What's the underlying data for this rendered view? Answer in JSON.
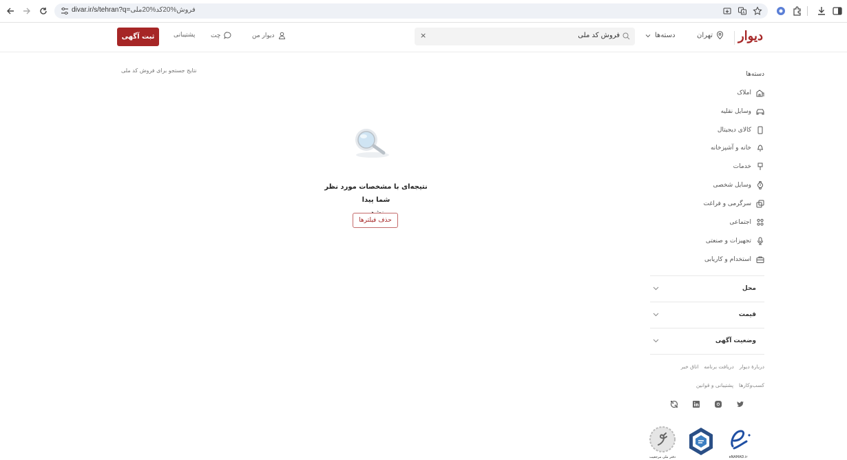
{
  "browser": {
    "url_host": "divar.ir/s/tehran?q=",
    "url_query": "فروش%20کد%20ملی"
  },
  "header": {
    "logo": "دیوار",
    "city": "تهران",
    "categories_label": "دسته‌ها",
    "search_value": "فروش کد ملی",
    "my_divar": "دیوار من",
    "chat": "چت",
    "support": "پشتیبانی",
    "post_ad": "ثبت آگهی"
  },
  "main": {
    "result_note": "نتایج جستجو برای فروش کد ملی",
    "empty_line1": "نتیجه‌ای با مشخصات مورد نظر شما پیدا",
    "empty_line2": "نشد.",
    "clear_filters": "حذف فیلترها"
  },
  "sidebar": {
    "heading": "دسته‌ها",
    "categories": [
      {
        "label": "املاک",
        "icon": "building-icon"
      },
      {
        "label": "وسایل نقلیه",
        "icon": "car-icon"
      },
      {
        "label": "کالای دیجیتال",
        "icon": "phone-icon"
      },
      {
        "label": "خانه و آشپزخانه",
        "icon": "lamp-icon"
      },
      {
        "label": "خدمات",
        "icon": "brush-icon"
      },
      {
        "label": "وسایل شخصی",
        "icon": "watch-icon"
      },
      {
        "label": "سرگرمی و فراغت",
        "icon": "puzzle-icon"
      },
      {
        "label": "اجتماعی",
        "icon": "people-icon"
      },
      {
        "label": "تجهیزات و صنعتی",
        "icon": "microphone-icon"
      },
      {
        "label": "استخدام و کاریابی",
        "icon": "briefcase-icon"
      }
    ],
    "filters": [
      "محل",
      "قیمت",
      "وضعیت آگهی"
    ],
    "footer_links_row1": [
      "دربارهٔ دیوار",
      "دریافت برنامه",
      "اتاق خبر"
    ],
    "footer_links_row2": [
      "کسب‌وکارها",
      "پشتیبانی و قوانین"
    ],
    "social": [
      "twitter-icon",
      "instagram-icon",
      "linkedin-icon",
      "aparat-icon"
    ],
    "badges": [
      "enamad-badge",
      "samandehi-badge",
      "digital-media-badge"
    ],
    "badge_captions": [
      "eNAMAD.ir",
      "",
      "دفتر ملی مرجعیت"
    ]
  },
  "colors": {
    "brand": "#a62626",
    "sidebar_text": "#555555"
  }
}
